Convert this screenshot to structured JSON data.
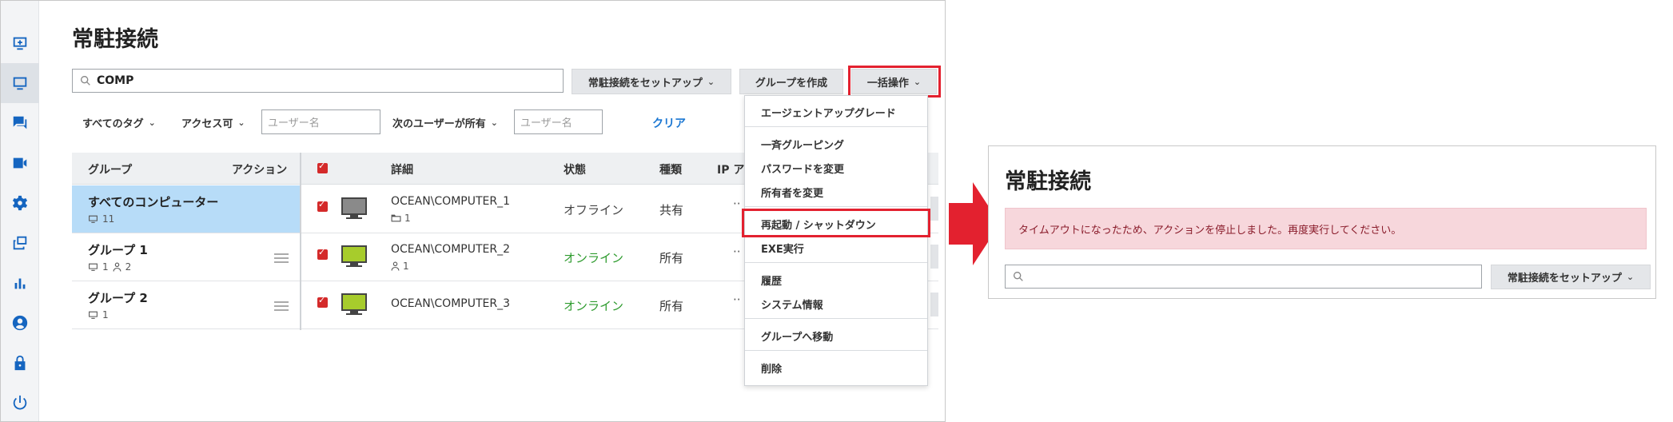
{
  "left_window": {
    "title": "常駐接続",
    "search_value": "COMP",
    "buttons": {
      "setup": "常駐接続をセットアップ",
      "create_group": "グループを作成",
      "bulk": "一括操作"
    },
    "filters": {
      "tags": "すべてのタグ",
      "access": "アクセス可",
      "user_placeholder": "ユーザー名",
      "owner": "次のユーザーが所有",
      "owner_placeholder": "ユーザー名",
      "clear": "クリア"
    },
    "groups_panel": {
      "header_group": "グループ",
      "header_action": "アクション",
      "items": [
        {
          "name": "すべてのコンピューター",
          "computers": "11"
        },
        {
          "name": "グループ 1",
          "computers": "1",
          "users": "2"
        },
        {
          "name": "グループ 2",
          "computers": "1"
        }
      ]
    },
    "table": {
      "headers": {
        "details": "詳細",
        "state": "状態",
        "kind": "種類",
        "ip": "IP ア"
      },
      "rows": [
        {
          "name": "OCEAN\\COMPUTER_1",
          "meta": "1",
          "state": "オフライン",
          "state_color": "#444444",
          "kind": "共有",
          "monitor_color": "#8a8a8a",
          "dots": "··"
        },
        {
          "name": "OCEAN\\COMPUTER_2",
          "meta": "1",
          "state": "オンライン",
          "state_color": "#2e9b2e",
          "kind": "所有",
          "monitor_color": "#a7cc2c",
          "dots": "··"
        },
        {
          "name": "OCEAN\\COMPUTER_3",
          "meta": "",
          "state": "オンライン",
          "state_color": "#2e9b2e",
          "kind": "所有",
          "monitor_color": "#a7cc2c",
          "dots": "··"
        }
      ]
    },
    "menu": {
      "items": [
        "エージェントアップグレード",
        "一斉グルーピング",
        "パスワードを変更",
        "所有者を変更",
        "再起動 / シャットダウン",
        "EXE実行",
        "履歴",
        "システム情報",
        "グループへ移動",
        "削除"
      ],
      "highlighted": "再起動 / シャットダウン"
    },
    "sidebar_icons": [
      "add-screen-icon",
      "monitor-icon",
      "chat-icon",
      "video-icon",
      "gear-icon",
      "copy-icon",
      "chart-icon",
      "user-icon",
      "lock-icon",
      "power-icon"
    ]
  },
  "right_window": {
    "title": "常駐接続",
    "alert": "タイムアウトになったため、アクションを停止しました。再度実行してください。",
    "search_value": "",
    "setup_button": "常駐接続をセットアップ"
  },
  "colors": {
    "accent": "#1565c0",
    "highlight_border": "#e3212f",
    "selected_group": "#b7dcf8",
    "alert_bg": "#f7d7dc",
    "arrow": "#e3212f"
  }
}
